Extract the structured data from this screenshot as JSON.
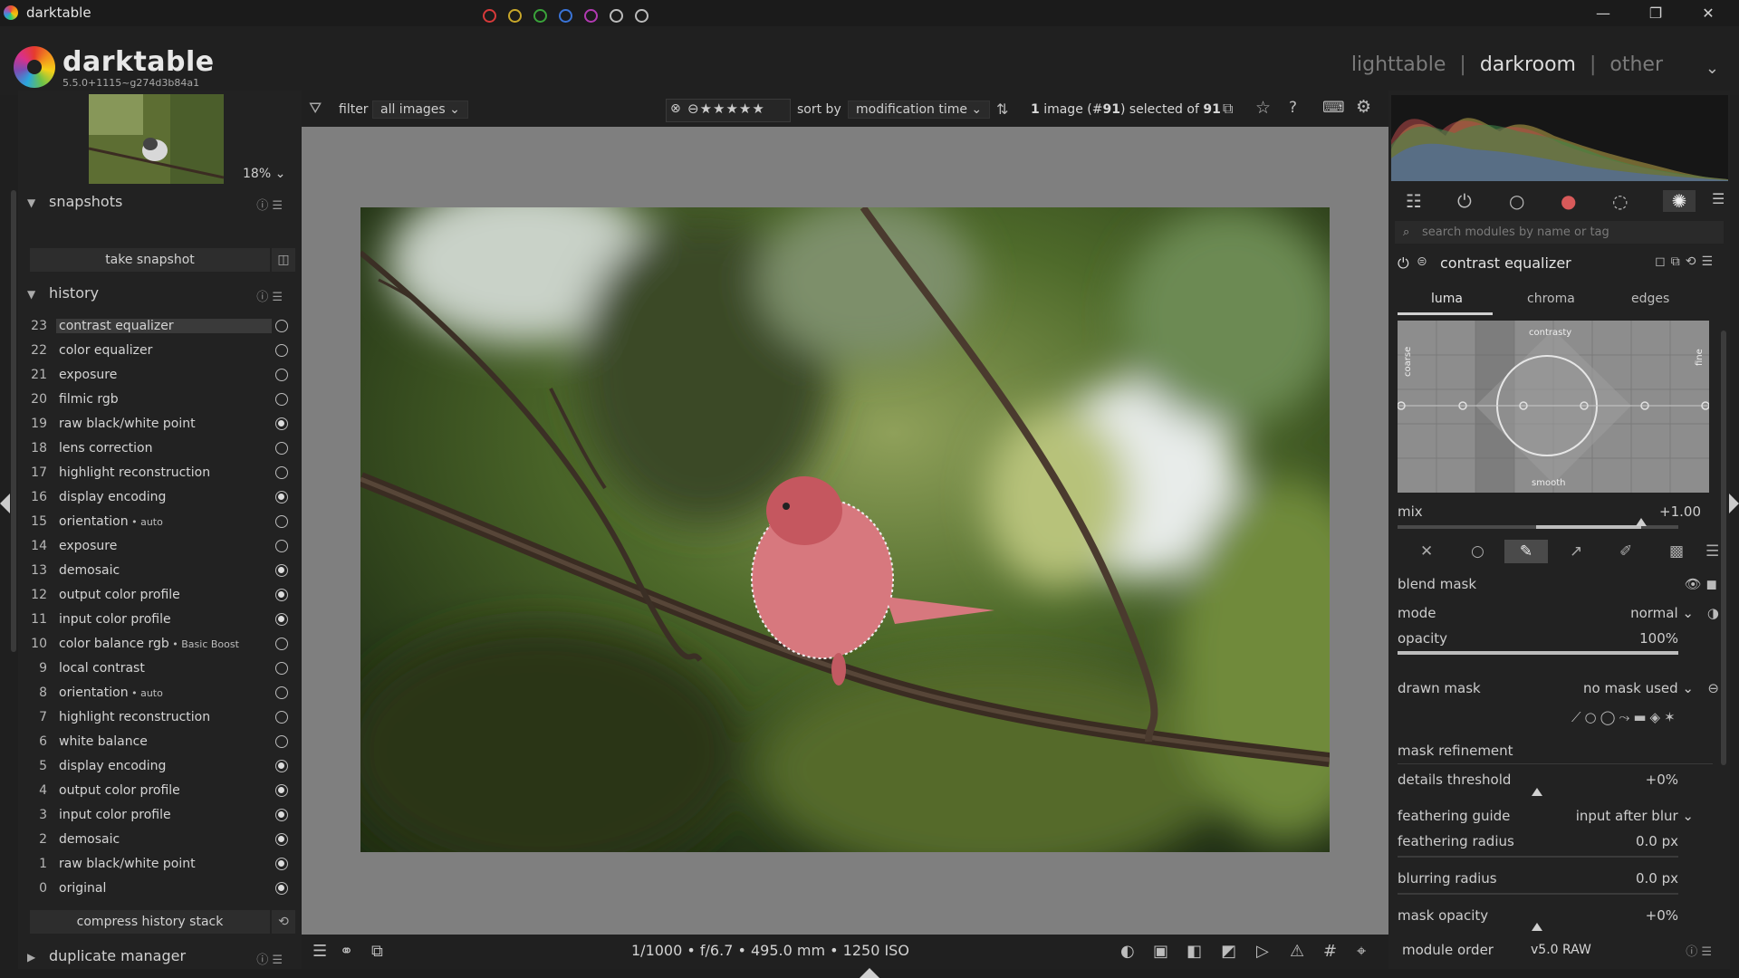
{
  "window": {
    "title": "darktable",
    "minimize": "—",
    "maximize": "❐",
    "close": "✕"
  },
  "header": {
    "app_name": "darktable",
    "version": "5.5.0+1115~g274d3b84a1",
    "views": [
      "lighttable",
      "darkroom",
      "other"
    ],
    "active_view": "darkroom",
    "separator": "|"
  },
  "left": {
    "zoom": "18%",
    "snapshots": {
      "title": "snapshots",
      "button": "take snapshot"
    },
    "history": {
      "title": "history",
      "items": [
        {
          "num": "23",
          "name": "contrast equalizer",
          "extra": "",
          "on": false,
          "selected": true
        },
        {
          "num": "22",
          "name": "color equalizer",
          "extra": "",
          "on": false
        },
        {
          "num": "21",
          "name": "exposure",
          "extra": "",
          "on": false
        },
        {
          "num": "20",
          "name": "filmic rgb",
          "extra": "",
          "on": false
        },
        {
          "num": "19",
          "name": "raw black/white point",
          "extra": "",
          "on": true
        },
        {
          "num": "18",
          "name": "lens correction",
          "extra": "",
          "on": false
        },
        {
          "num": "17",
          "name": "highlight reconstruction",
          "extra": "",
          "on": false
        },
        {
          "num": "16",
          "name": "display encoding",
          "extra": "",
          "on": true
        },
        {
          "num": "15",
          "name": "orientation",
          "extra": " • auto",
          "on": false
        },
        {
          "num": "14",
          "name": "exposure",
          "extra": "",
          "on": false
        },
        {
          "num": "13",
          "name": "demosaic",
          "extra": "",
          "on": true
        },
        {
          "num": "12",
          "name": "output color profile",
          "extra": "",
          "on": true
        },
        {
          "num": "11",
          "name": "input color profile",
          "extra": "",
          "on": true
        },
        {
          "num": "10",
          "name": "color balance rgb",
          "extra": " • Basic Boost",
          "on": false
        },
        {
          "num": "9",
          "name": "local contrast",
          "extra": "",
          "on": false
        },
        {
          "num": "8",
          "name": "orientation",
          "extra": " • auto",
          "on": false
        },
        {
          "num": "7",
          "name": "highlight reconstruction",
          "extra": "",
          "on": false
        },
        {
          "num": "6",
          "name": "white balance",
          "extra": "",
          "on": false
        },
        {
          "num": "5",
          "name": "display encoding",
          "extra": "",
          "on": true
        },
        {
          "num": "4",
          "name": "output color profile",
          "extra": "",
          "on": true
        },
        {
          "num": "3",
          "name": "input color profile",
          "extra": "",
          "on": true
        },
        {
          "num": "2",
          "name": "demosaic",
          "extra": "",
          "on": true
        },
        {
          "num": "1",
          "name": "raw black/white point",
          "extra": "",
          "on": true
        },
        {
          "num": "0",
          "name": "original",
          "extra": "",
          "on": true
        }
      ],
      "compress_button": "compress history stack"
    },
    "duplicate_manager": {
      "title": "duplicate manager"
    }
  },
  "filterbar": {
    "filter_label": "filter",
    "filter_value": "all images",
    "color_labels": [
      "#d73a3a",
      "#c8a72a",
      "#3aa33a",
      "#3a74d7",
      "#b23ab2"
    ],
    "sort_label": "sort by",
    "sort_value": "modification time",
    "selection_pre": "1 image (#",
    "selection_id": "91",
    "selection_mid": ") selected of ",
    "selection_total": "91"
  },
  "image_info": {
    "exif": "1/1000 • f/6.7 • 495.0 mm • 1250 ISO"
  },
  "right": {
    "search_placeholder": "search modules by name or tag",
    "module": {
      "name": "contrast equalizer",
      "tabs": [
        "luma",
        "chroma",
        "edges"
      ],
      "active_tab": "luma",
      "graph_labels": {
        "top": "contrasty",
        "bottom": "smooth",
        "left": "coarse",
        "right": "fine"
      },
      "mix_label": "mix",
      "mix_value": "+1.00",
      "mix_fraction": 0.74
    },
    "blend": {
      "blend_mask_label": "blend mask",
      "mode_label": "mode",
      "mode_value": "normal",
      "opacity_label": "opacity",
      "opacity_value": "100%",
      "opacity_fraction": 1.0,
      "drawn_mask_label": "drawn mask",
      "drawn_mask_value": "no mask used",
      "mask_refinement_label": "mask refinement",
      "details_threshold_label": "details threshold",
      "details_threshold_value": "+0%",
      "feathering_guide_label": "feathering guide",
      "feathering_guide_value": "input after blur",
      "feathering_radius_label": "feathering radius",
      "feathering_radius_value": "0.0 px",
      "blurring_radius_label": "blurring radius",
      "blurring_radius_value": "0.0 px",
      "mask_opacity_label": "mask opacity",
      "mask_opacity_value": "+0%"
    },
    "module_order_label": "module order",
    "module_order_value": "v5.0 RAW"
  }
}
